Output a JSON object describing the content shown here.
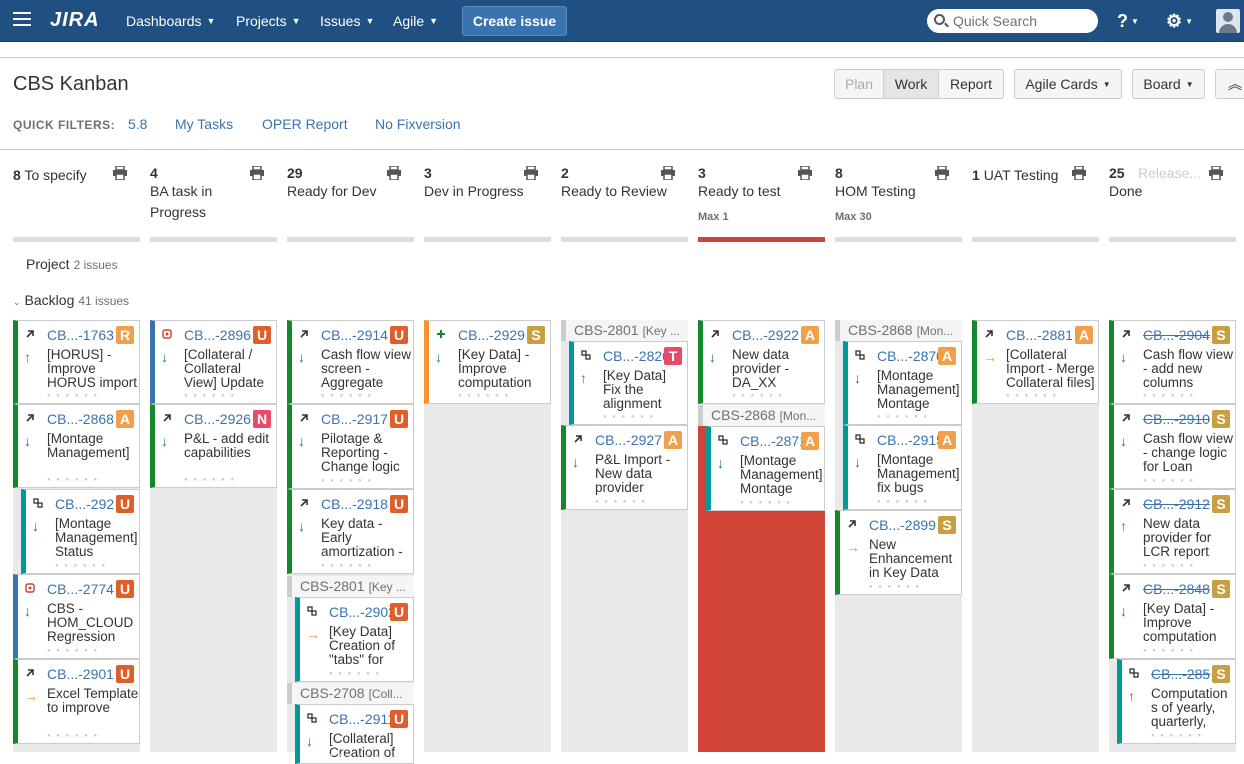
{
  "topbar": {
    "logo": "JIRA",
    "nav": [
      "Dashboards",
      "Projects",
      "Issues",
      "Agile"
    ],
    "create": "Create issue",
    "search_placeholder": "Quick Search",
    "help_icon": "?",
    "gear_icon": "⚙"
  },
  "board": {
    "title": "CBS Kanban",
    "modes": [
      "Plan",
      "Work",
      "Report"
    ],
    "agile_cards": "Agile Cards",
    "board_menu": "Board"
  },
  "quick_filters": {
    "label": "QUICK FILTERS:",
    "items": [
      "5.8",
      "My Tasks",
      "OPER Report",
      "No Fixversion"
    ]
  },
  "columns": [
    {
      "count": "8",
      "name": "To specify",
      "max": ""
    },
    {
      "count": "4",
      "name": "BA task in Progress",
      "max": ""
    },
    {
      "count": "29",
      "name": "Ready for Dev",
      "max": ""
    },
    {
      "count": "3",
      "name": "Dev in Progress",
      "max": ""
    },
    {
      "count": "2",
      "name": "Ready to Review",
      "max": ""
    },
    {
      "count": "3",
      "name": "Ready to test",
      "max": "Max 1"
    },
    {
      "count": "8",
      "name": "HOM Testing",
      "max": "Max 30"
    },
    {
      "count": "1",
      "name": "UAT Testing",
      "max": ""
    },
    {
      "count": "25",
      "name": "Done",
      "max": "",
      "release": "Release..."
    }
  ],
  "swimlanes": {
    "project": {
      "label": "Project",
      "count": "2 issues"
    },
    "backlog": {
      "label": "Backlog",
      "count": "41 issues"
    }
  },
  "parents": [
    {
      "key": "CBS-2801",
      "summary": "[Key ..."
    },
    {
      "key": "CBS-2801",
      "summary": "[Key ..."
    },
    {
      "key": "CBS-2708",
      "summary": "[Coll..."
    },
    {
      "key": "CBS-2868",
      "summary": "[Mon..."
    },
    {
      "key": "CBS-2868",
      "summary": "[Mon..."
    }
  ],
  "cards": [
    {
      "key": "CB...-1763",
      "summary": "[HORUS] - Improve HORUS import",
      "avatar": "R",
      "priority": "up"
    },
    {
      "key": "CB...-2868",
      "summary": "[Montage Management]",
      "avatar": "A",
      "priority": "down"
    },
    {
      "key": "CB...-292",
      "summary": "[Montage Management] Status",
      "avatar": "U",
      "priority": "down"
    },
    {
      "key": "CB...-2774",
      "summary": "CBS - HOM_CLOUD Regression",
      "avatar": "U",
      "priority": "down"
    },
    {
      "key": "CB...-2901",
      "summary": "Excel Template to improve",
      "avatar": "U",
      "priority": "right"
    },
    {
      "key": "CB...-2896",
      "summary": "[Collateral / Collateral View] Update",
      "avatar": "U",
      "priority": "down"
    },
    {
      "key": "CB...-2926",
      "summary": "P&L - add edit capabilities",
      "avatar": "N",
      "priority": "down"
    },
    {
      "key": "CB...-2914",
      "summary": "Cash flow view screen - Aggregate",
      "avatar": "U",
      "priority": "down"
    },
    {
      "key": "CB...-2917",
      "summary": "Pilotage & Reporting - Change logic",
      "avatar": "U",
      "priority": "down"
    },
    {
      "key": "CB...-2918",
      "summary": "Key data - Early amortization -",
      "avatar": "U",
      "priority": "down"
    },
    {
      "key": "CB...-2902",
      "summary": "[Key Data] Creation of \"tabs\" for",
      "avatar": "U",
      "priority": "right"
    },
    {
      "key": "CB...-2911",
      "summary": "[Collateral] Creation of",
      "avatar": "U",
      "priority": "down"
    },
    {
      "key": "CB...-2929",
      "summary": "[Key Data] - Improve computation",
      "avatar": "S",
      "priority": "down"
    },
    {
      "key": "CB...-2820",
      "summary": "[Key Data] Fix the alignment",
      "avatar": "T",
      "priority": "up"
    },
    {
      "key": "CB...-2927",
      "summary": "P&L Import - New data provider",
      "avatar": "A",
      "priority": "down"
    },
    {
      "key": "CB...-2922",
      "summary": "New data provider - DA_XX",
      "avatar": "A",
      "priority": "down"
    },
    {
      "key": "CB...-2871",
      "summary": "[Montage Management] Montage",
      "avatar": "A",
      "priority": "down"
    },
    {
      "key": "CB...-2870",
      "summary": "[Montage Management] Montage",
      "avatar": "A",
      "priority": "down"
    },
    {
      "key": "CB...-2915",
      "summary": "[Montage Management] fix bugs",
      "avatar": "A",
      "priority": "down"
    },
    {
      "key": "CB...-2899",
      "summary": "New Enhancement in Key Data",
      "avatar": "S",
      "priority": "right"
    },
    {
      "key": "CB...-2881",
      "summary": "[Collateral Import - Merge Collateral files]",
      "avatar": "A",
      "priority": "right"
    },
    {
      "key": "CB...-2904",
      "summary": "Cash flow view - add new columns",
      "avatar": "S",
      "priority": "down"
    },
    {
      "key": "CB...-2910",
      "summary": "Cash flow view - change logic for Loan",
      "avatar": "S",
      "priority": "down"
    },
    {
      "key": "CB...-2912",
      "summary": "New data provider for LCR report",
      "avatar": "S",
      "priority": "up"
    },
    {
      "key": "CB...-2848",
      "summary": "[Key Data] - Improve computation",
      "avatar": "S",
      "priority": "down"
    },
    {
      "key": "CB...-285",
      "summary": "Computation s of yearly, quarterly,",
      "avatar": "S",
      "priority": "up"
    }
  ],
  "colors": {
    "header": "#205081",
    "link": "#3b73af",
    "story": "#14892c",
    "task": "#3b73af",
    "epic": "#f79232",
    "subtask": "#009999",
    "overflow": "#d04437",
    "av_U": "#e05e2a",
    "av_A": "#f0a04b",
    "av_S": "#c9a041",
    "av_R": "#f0a04b",
    "av_N": "#e84a6a",
    "av_T": "#e84a6a"
  }
}
